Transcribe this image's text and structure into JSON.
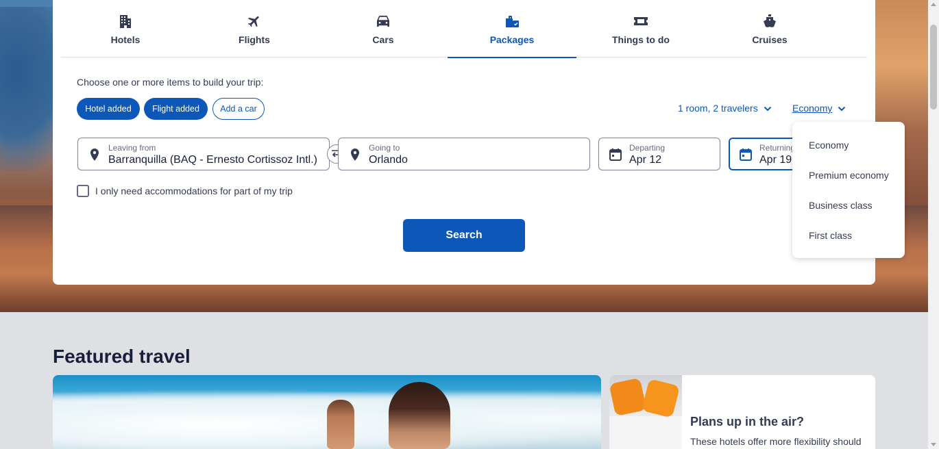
{
  "tabs": [
    {
      "label": "Hotels",
      "icon": "hotel-icon",
      "active": false
    },
    {
      "label": "Flights",
      "icon": "plane-icon",
      "active": false
    },
    {
      "label": "Cars",
      "icon": "car-icon",
      "active": false
    },
    {
      "label": "Packages",
      "icon": "packages-icon",
      "active": true
    },
    {
      "label": "Things to do",
      "icon": "ticket-icon",
      "active": false
    },
    {
      "label": "Cruises",
      "icon": "cruise-icon",
      "active": false
    }
  ],
  "builder": {
    "prompt": "Choose one or more items to build your trip:",
    "chips": [
      {
        "label": "Hotel added",
        "state": "added"
      },
      {
        "label": "Flight added",
        "state": "added"
      },
      {
        "label": "Add a car",
        "state": "not-added"
      }
    ],
    "travelers": "1 room, 2 travelers",
    "cabin_class": "Economy"
  },
  "fields": {
    "leaving_from": {
      "label": "Leaving from",
      "value": "Barranquilla (BAQ - Ernesto Cortissoz Intl.)"
    },
    "going_to": {
      "label": "Going to",
      "value": "Orlando"
    },
    "departing": {
      "label": "Departing",
      "value": "Apr 12"
    },
    "returning": {
      "label": "Returning",
      "value": "Apr 19"
    }
  },
  "partial_stay_label": "I only need accommodations for part of my trip",
  "search_label": "Search",
  "cabin_dropdown": {
    "options": [
      "Economy",
      "Premium economy",
      "Business class",
      "First class"
    ]
  },
  "featured": {
    "title": "Featured travel",
    "card2_heading": "Plans up in the air?",
    "card2_text": "These hotels offer more flexibility should"
  },
  "colors": {
    "brand": "#0d57b9",
    "text": "#343b53",
    "page_bg": "#dfe0e4"
  }
}
